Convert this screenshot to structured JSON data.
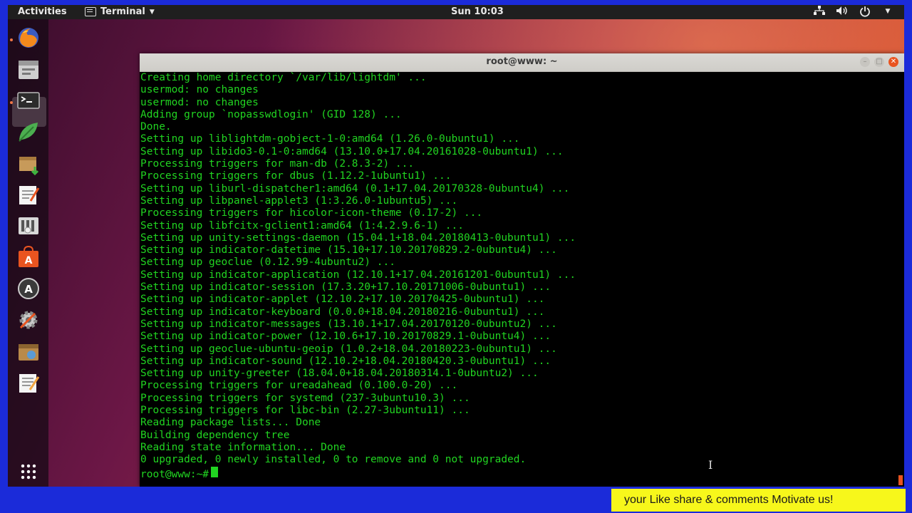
{
  "topbar": {
    "activities": "Activities",
    "app_menu": "Terminal",
    "clock": "Sun 10:03",
    "tray_icons": [
      "network-icon",
      "volume-icon",
      "power-icon",
      "caret-down-icon"
    ]
  },
  "dock": {
    "apps": [
      "firefox-icon",
      "files-icon",
      "terminal-icon",
      "leaf-app-icon",
      "package-icon",
      "text-editor-icon",
      "system-monitor-icon",
      "software-center-icon",
      "software-updater-icon",
      "settings-icon",
      "archive-icon",
      "notes-icon"
    ],
    "show_apps": "apps-grid-icon"
  },
  "window": {
    "title": "root@www: ~"
  },
  "terminal": {
    "lines": [
      "Creating home directory `/var/lib/lightdm' ...",
      "usermod: no changes",
      "usermod: no changes",
      "Adding group `nopasswdlogin' (GID 128) ...",
      "Done.",
      "Setting up liblightdm-gobject-1-0:amd64 (1.26.0-0ubuntu1) ...",
      "Setting up libido3-0.1-0:amd64 (13.10.0+17.04.20161028-0ubuntu1) ...",
      "Processing triggers for man-db (2.8.3-2) ...",
      "Processing triggers for dbus (1.12.2-1ubuntu1) ...",
      "Setting up liburl-dispatcher1:amd64 (0.1+17.04.20170328-0ubuntu4) ...",
      "Setting up libpanel-applet3 (1:3.26.0-1ubuntu5) ...",
      "Processing triggers for hicolor-icon-theme (0.17-2) ...",
      "Setting up libfcitx-gclient1:amd64 (1:4.2.9.6-1) ...",
      "Setting up unity-settings-daemon (15.04.1+18.04.20180413-0ubuntu1) ...",
      "Setting up indicator-datetime (15.10+17.10.20170829.2-0ubuntu4) ...",
      "Setting up geoclue (0.12.99-4ubuntu2) ...",
      "Setting up indicator-application (12.10.1+17.04.20161201-0ubuntu1) ...",
      "Setting up indicator-session (17.3.20+17.10.20171006-0ubuntu1) ...",
      "Setting up indicator-applet (12.10.2+17.10.20170425-0ubuntu1) ...",
      "Setting up indicator-keyboard (0.0.0+18.04.20180216-0ubuntu1) ...",
      "Setting up indicator-messages (13.10.1+17.04.20170120-0ubuntu2) ...",
      "Setting up indicator-power (12.10.6+17.10.20170829.1-0ubuntu4) ...",
      "Setting up geoclue-ubuntu-geoip (1.0.2+18.04.20180223-0ubuntu1) ...",
      "Setting up indicator-sound (12.10.2+18.04.20180420.3-0ubuntu1) ...",
      "Setting up unity-greeter (18.04.0+18.04.20180314.1-0ubuntu2) ...",
      "Processing triggers for ureadahead (0.100.0-20) ...",
      "Processing triggers for systemd (237-3ubuntu10.3) ...",
      "Processing triggers for libc-bin (2.27-3ubuntu11) ...",
      "Reading package lists... Done",
      "Building dependency tree",
      "Reading state information... Done",
      "0 upgraded, 0 newly installed, 0 to remove and 0 not upgraded."
    ],
    "prompt": "root@www:~#"
  },
  "caption": "your Like share & comments Motivate us!",
  "colors": {
    "terminal_text": "#21d421",
    "accent": "#e95420",
    "caption_bg": "#f7f71b",
    "frame_bg": "#1b2bd9"
  }
}
